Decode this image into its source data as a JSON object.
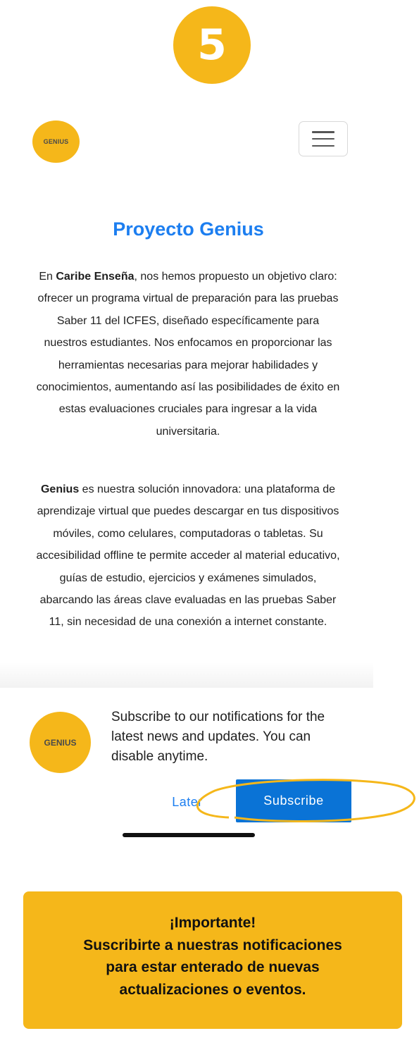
{
  "step": "5",
  "header": {
    "logo_text": "GENIUS",
    "menu_icon": "hamburger-menu-icon"
  },
  "main": {
    "title": "Proyecto Genius",
    "paragraph1": {
      "prefix": "En ",
      "bold": "Caribe Enseña",
      "text": ", nos hemos propuesto un objetivo claro: ofrecer un programa virtual de preparación para las pruebas Saber 11 del ICFES, diseñado específicamente para nuestros estudiantes. Nos enfocamos en proporcionar las herramientas necesarias para mejorar habilidades y conocimientos, aumentando así las posibilidades de éxito en estas evaluaciones cruciales para ingresar a la vida universitaria."
    },
    "paragraph2": {
      "bold": "Genius",
      "text": " es nuestra solución innovadora: una plataforma de aprendizaje virtual que puedes descargar en tus dispositivos móviles, como celulares, computadoras o tabletas. Su accesibilidad offline te permite acceder al material educativo, guías de estudio, ejercicios y exámenes simulados, abarcando las áreas clave evaluadas en las pruebas Saber 11, sin necesidad de una conexión a internet constante."
    }
  },
  "prompt": {
    "logo_text": "GENIUS",
    "message": "Subscribe to our notifications for the latest news and updates. You can disable anytime.",
    "later_label": "Later",
    "subscribe_label": "Subscribe"
  },
  "notice": {
    "line1": "¡Importante!",
    "line2": "Suscribirte a nuestras notificaciones",
    "line3": "para estar enterado de nuevas",
    "line4": "actualizaciones o eventos."
  },
  "colors": {
    "brand_yellow": "#F5B71A",
    "title_blue": "#1c7ef0",
    "button_blue": "#0a73d6"
  }
}
